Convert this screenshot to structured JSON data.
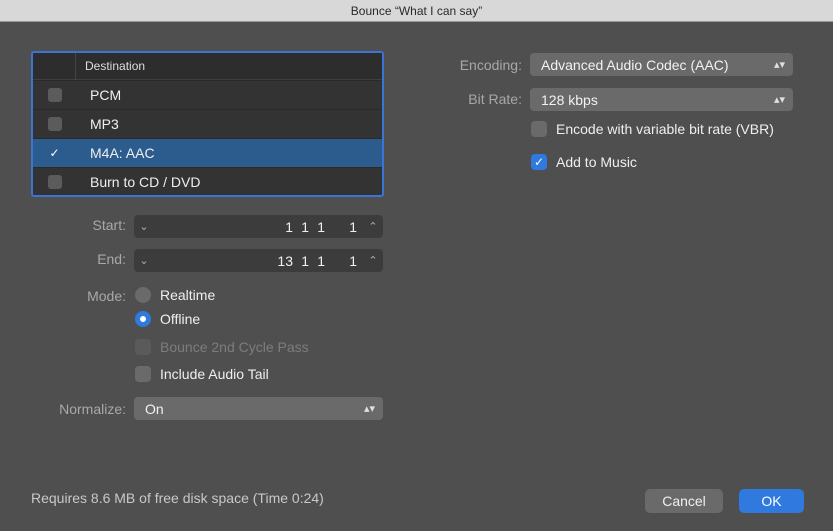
{
  "window": {
    "title": "Bounce “What I can say”"
  },
  "destination": {
    "header": "Destination",
    "rows": [
      {
        "label": "PCM",
        "checked": false
      },
      {
        "label": "MP3",
        "checked": false
      },
      {
        "label": "M4A: AAC",
        "checked": true
      },
      {
        "label": "Burn to CD / DVD",
        "checked": false
      }
    ]
  },
  "start": {
    "label": "Start:",
    "bar": "1",
    "beat": "1",
    "division": "1",
    "tick": "1"
  },
  "end": {
    "label": "End:",
    "bar": "13",
    "beat": "1",
    "division": "1",
    "tick": "1"
  },
  "mode": {
    "label": "Mode:",
    "realtime": "Realtime",
    "offline": "Offline",
    "bounce_2nd_cycle": "Bounce 2nd Cycle Pass",
    "include_audio_tail": "Include Audio Tail"
  },
  "normalize": {
    "label": "Normalize:",
    "value": "On"
  },
  "encoding": {
    "label": "Encoding:",
    "value": "Advanced Audio Codec (AAC)"
  },
  "bitrate": {
    "label": "Bit Rate:",
    "value": "128 kbps"
  },
  "vbr": {
    "label": "Encode with variable bit rate (VBR)",
    "checked": false
  },
  "add_to_music": {
    "label": "Add to Music",
    "checked": true
  },
  "footer": {
    "disk_space": "Requires 8.6 MB of free disk space  (Time 0:24)",
    "cancel": "Cancel",
    "ok": "OK"
  },
  "icons": {
    "check": "✓",
    "chevron_down": "⌄",
    "chevron_up": "⌃",
    "updown": "▴▾"
  },
  "colors": {
    "accent": "#2f79df",
    "selection": "#2c5b8e",
    "focus_ring": "#3b74d4"
  }
}
